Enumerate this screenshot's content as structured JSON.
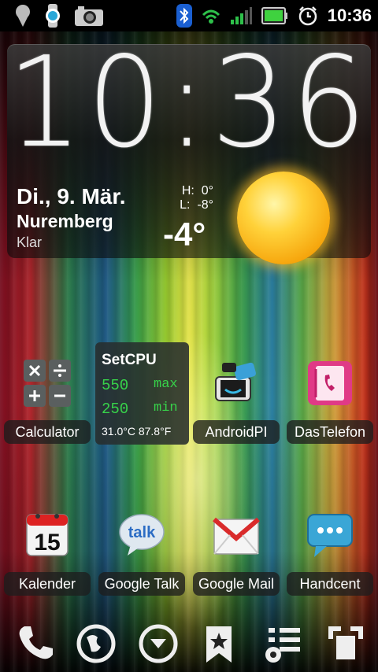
{
  "status_bar": {
    "time": "10:36",
    "icons": [
      "location-pin-icon",
      "watch-icon",
      "camera-icon",
      "bluetooth-icon",
      "wifi-icon",
      "signal-icon",
      "battery-icon",
      "alarm-icon"
    ]
  },
  "clock_widget": {
    "time": "10:36",
    "date": "Di., 9. Mär.",
    "city": "Nuremberg",
    "condition": "Klar",
    "high_label": "H:",
    "high_value": "0°",
    "low_label": "L:",
    "low_value": "-8°",
    "temperature": "-4°",
    "weather_icon": "sun-icon"
  },
  "apps_row1": [
    {
      "label": "Calculator",
      "icon": "calculator-icon"
    },
    {
      "label": "AndroidPI",
      "icon": "androidpit-icon"
    },
    {
      "label": "DasTelefon",
      "icon": "phonebook-icon"
    }
  ],
  "setcpu": {
    "title": "SetCPU",
    "max_value": "550",
    "max_label": "max",
    "min_value": "250",
    "min_label": "min",
    "temps": "31.0°C 87.8°F"
  },
  "apps_row2": [
    {
      "label": "Kalender",
      "icon": "calendar-icon",
      "day": "15"
    },
    {
      "label": "Google Talk",
      "icon": "talk-icon",
      "text": "talk"
    },
    {
      "label": "Google Mail",
      "icon": "gmail-icon"
    },
    {
      "label": "Handcent",
      "icon": "messaging-icon"
    }
  ],
  "dock": [
    "phone-icon",
    "browser-icon",
    "app-drawer-icon",
    "bookmark-icon",
    "settings-list-icon",
    "screens-icon"
  ]
}
